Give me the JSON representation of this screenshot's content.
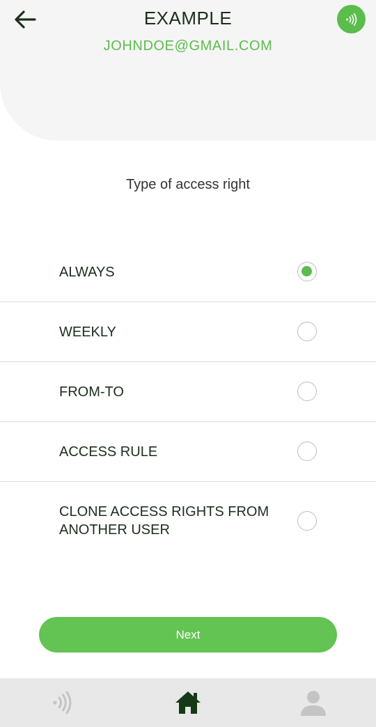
{
  "header": {
    "title": "EXAMPLE",
    "email": "JOHNDOE@GMAIL.COM",
    "back_icon": "arrow-left-icon",
    "nfc_icon": "nfc-signal-icon"
  },
  "colors": {
    "accent": "#5bbd4c",
    "dark_text": "#1c2e1c",
    "header_bg": "#f5f5f5",
    "nav_bg": "#e8e8e8"
  },
  "section": {
    "label": "Type of access right"
  },
  "options": [
    {
      "label": "ALWAYS",
      "checked": true
    },
    {
      "label": "WEEKLY",
      "checked": false
    },
    {
      "label": "FROM-TO",
      "checked": false
    },
    {
      "label": "ACCESS RULE",
      "checked": false
    },
    {
      "label": "CLONE ACCESS RIGHTS FROM ANOTHER USER",
      "checked": false
    }
  ],
  "actions": {
    "next_label": "Next"
  },
  "bottom_nav": {
    "items": [
      {
        "icon": "nfc-signal-icon",
        "active": false
      },
      {
        "icon": "home-icon",
        "active": true
      },
      {
        "icon": "user-icon",
        "active": false
      }
    ]
  }
}
